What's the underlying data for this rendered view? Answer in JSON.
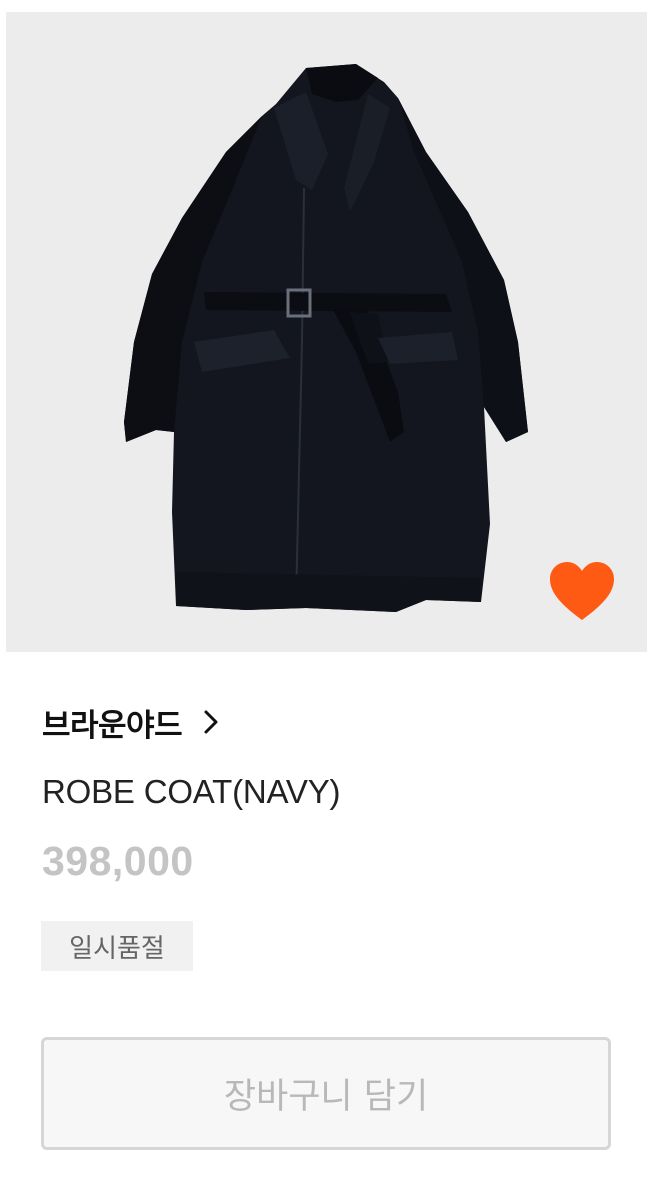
{
  "product": {
    "image_alt": "ROBE COAT(NAVY)",
    "wishlist_color": "#ff5a14",
    "brand": "브라운야드",
    "name": "ROBE COAT(NAVY)",
    "price": "398,000",
    "status_badge": "일시품절"
  },
  "actions": {
    "add_to_cart_label": "장바구니 담기"
  },
  "icons": {
    "wishlist": "heart-icon",
    "brand_link": "chevron-right-icon"
  }
}
